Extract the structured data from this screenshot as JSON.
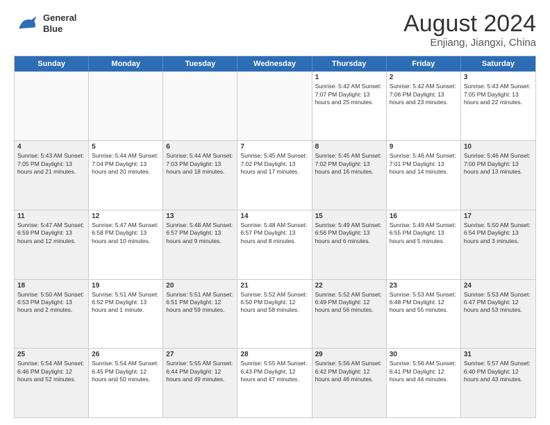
{
  "logo": {
    "line1": "General",
    "line2": "Blue"
  },
  "title": "August 2024",
  "location": "Enjiang, Jiangxi, China",
  "weekdays": [
    "Sunday",
    "Monday",
    "Tuesday",
    "Wednesday",
    "Thursday",
    "Friday",
    "Saturday"
  ],
  "rows": [
    [
      {
        "day": "",
        "info": "",
        "empty": true
      },
      {
        "day": "",
        "info": "",
        "empty": true
      },
      {
        "day": "",
        "info": "",
        "empty": true
      },
      {
        "day": "",
        "info": "",
        "empty": true
      },
      {
        "day": "1",
        "info": "Sunrise: 5:42 AM\nSunset: 7:07 PM\nDaylight: 13 hours\nand 25 minutes."
      },
      {
        "day": "2",
        "info": "Sunrise: 5:42 AM\nSunset: 7:06 PM\nDaylight: 13 hours\nand 23 minutes."
      },
      {
        "day": "3",
        "info": "Sunrise: 5:43 AM\nSunset: 7:05 PM\nDaylight: 13 hours\nand 22 minutes."
      }
    ],
    [
      {
        "day": "4",
        "info": "Sunrise: 5:43 AM\nSunset: 7:05 PM\nDaylight: 13 hours\nand 21 minutes.",
        "shaded": true
      },
      {
        "day": "5",
        "info": "Sunrise: 5:44 AM\nSunset: 7:04 PM\nDaylight: 13 hours\nand 20 minutes."
      },
      {
        "day": "6",
        "info": "Sunrise: 5:44 AM\nSunset: 7:03 PM\nDaylight: 13 hours\nand 18 minutes.",
        "shaded": true
      },
      {
        "day": "7",
        "info": "Sunrise: 5:45 AM\nSunset: 7:02 PM\nDaylight: 13 hours\nand 17 minutes."
      },
      {
        "day": "8",
        "info": "Sunrise: 5:45 AM\nSunset: 7:02 PM\nDaylight: 13 hours\nand 16 minutes.",
        "shaded": true
      },
      {
        "day": "9",
        "info": "Sunrise: 5:46 AM\nSunset: 7:01 PM\nDaylight: 13 hours\nand 14 minutes."
      },
      {
        "day": "10",
        "info": "Sunrise: 5:46 AM\nSunset: 7:00 PM\nDaylight: 13 hours\nand 13 minutes.",
        "shaded": true
      }
    ],
    [
      {
        "day": "11",
        "info": "Sunrise: 5:47 AM\nSunset: 6:59 PM\nDaylight: 13 hours\nand 12 minutes.",
        "shaded": true
      },
      {
        "day": "12",
        "info": "Sunrise: 5:47 AM\nSunset: 6:58 PM\nDaylight: 13 hours\nand 10 minutes."
      },
      {
        "day": "13",
        "info": "Sunrise: 5:48 AM\nSunset: 6:57 PM\nDaylight: 13 hours\nand 9 minutes.",
        "shaded": true
      },
      {
        "day": "14",
        "info": "Sunrise: 5:48 AM\nSunset: 6:57 PM\nDaylight: 13 hours\nand 8 minutes."
      },
      {
        "day": "15",
        "info": "Sunrise: 5:49 AM\nSunset: 6:56 PM\nDaylight: 13 hours\nand 6 minutes.",
        "shaded": true
      },
      {
        "day": "16",
        "info": "Sunrise: 5:49 AM\nSunset: 6:55 PM\nDaylight: 13 hours\nand 5 minutes."
      },
      {
        "day": "17",
        "info": "Sunrise: 5:50 AM\nSunset: 6:54 PM\nDaylight: 13 hours\nand 3 minutes.",
        "shaded": true
      }
    ],
    [
      {
        "day": "18",
        "info": "Sunrise: 5:50 AM\nSunset: 6:53 PM\nDaylight: 13 hours\nand 2 minutes.",
        "shaded": true
      },
      {
        "day": "19",
        "info": "Sunrise: 5:51 AM\nSunset: 6:52 PM\nDaylight: 13 hours\nand 1 minute."
      },
      {
        "day": "20",
        "info": "Sunrise: 5:51 AM\nSunset: 6:51 PM\nDaylight: 12 hours\nand 59 minutes.",
        "shaded": true
      },
      {
        "day": "21",
        "info": "Sunrise: 5:52 AM\nSunset: 6:50 PM\nDaylight: 12 hours\nand 58 minutes."
      },
      {
        "day": "22",
        "info": "Sunrise: 5:52 AM\nSunset: 6:49 PM\nDaylight: 12 hours\nand 56 minutes.",
        "shaded": true
      },
      {
        "day": "23",
        "info": "Sunrise: 5:53 AM\nSunset: 6:48 PM\nDaylight: 12 hours\nand 55 minutes."
      },
      {
        "day": "24",
        "info": "Sunrise: 5:53 AM\nSunset: 6:47 PM\nDaylight: 12 hours\nand 53 minutes.",
        "shaded": true
      }
    ],
    [
      {
        "day": "25",
        "info": "Sunrise: 5:54 AM\nSunset: 6:46 PM\nDaylight: 12 hours\nand 52 minutes.",
        "shaded": true
      },
      {
        "day": "26",
        "info": "Sunrise: 5:54 AM\nSunset: 6:45 PM\nDaylight: 12 hours\nand 50 minutes."
      },
      {
        "day": "27",
        "info": "Sunrise: 5:55 AM\nSunset: 6:44 PM\nDaylight: 12 hours\nand 49 minutes.",
        "shaded": true
      },
      {
        "day": "28",
        "info": "Sunrise: 5:55 AM\nSunset: 6:43 PM\nDaylight: 12 hours\nand 47 minutes."
      },
      {
        "day": "29",
        "info": "Sunrise: 5:56 AM\nSunset: 6:42 PM\nDaylight: 12 hours\nand 46 minutes.",
        "shaded": true
      },
      {
        "day": "30",
        "info": "Sunrise: 5:56 AM\nSunset: 6:41 PM\nDaylight: 12 hours\nand 44 minutes."
      },
      {
        "day": "31",
        "info": "Sunrise: 5:57 AM\nSunset: 6:40 PM\nDaylight: 12 hours\nand 43 minutes.",
        "shaded": true
      }
    ]
  ]
}
